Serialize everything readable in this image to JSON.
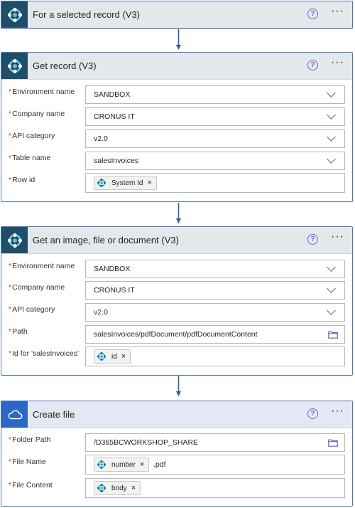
{
  "trigger": {
    "title": "For a selected record (V3)"
  },
  "get_record": {
    "title": "Get record (V3)",
    "fields": [
      {
        "label": "Environment name",
        "value": "SANDBOX"
      },
      {
        "label": "Company name",
        "value": "CRONUS IT"
      },
      {
        "label": "API category",
        "value": "v2.0"
      },
      {
        "label": "Table name",
        "value": "salesInvoices"
      },
      {
        "label": "Row id",
        "token": "System Id"
      }
    ]
  },
  "get_image": {
    "title": "Get an image, file or document (V3)",
    "fields": [
      {
        "label": "Environment name",
        "value": "SANDBOX"
      },
      {
        "label": "Company name",
        "value": "CRONUS IT"
      },
      {
        "label": "API category",
        "value": "v2.0"
      },
      {
        "label": "Path",
        "value": "salesInvoices/pdfDocument/pdfDocumentContent"
      },
      {
        "label": "Id for 'salesInvoices'",
        "token": "id"
      }
    ]
  },
  "create_file": {
    "title": "Create file",
    "fields": [
      {
        "label": "Folder Path",
        "value": "/D365BCWORKSHOP_SHARE"
      },
      {
        "label": "File Name",
        "token": "number",
        "suffix": ".pdf"
      },
      {
        "label": "File Content",
        "token": "body"
      }
    ]
  },
  "common": {
    "required_mark": "*",
    "help_glyph": "?",
    "more_glyph": "···",
    "remove_glyph": "×"
  },
  "icons": {
    "bc_connector": "dynamics-365-business-central-icon",
    "onedrive_connector": "onedrive-cloud-icon",
    "dropdown": "chevron-down-icon",
    "folder": "folder-icon",
    "help": "help-circle-icon",
    "more": "ellipsis-icon",
    "flow_arrow": "arrow-down-icon"
  },
  "colors": {
    "accent": "#5b5fc7",
    "card_border": "#4a78b8",
    "bc_tile": "#1f4f68",
    "onedrive_tile": "#2d67c5",
    "arrow": "#2e5d9e"
  }
}
